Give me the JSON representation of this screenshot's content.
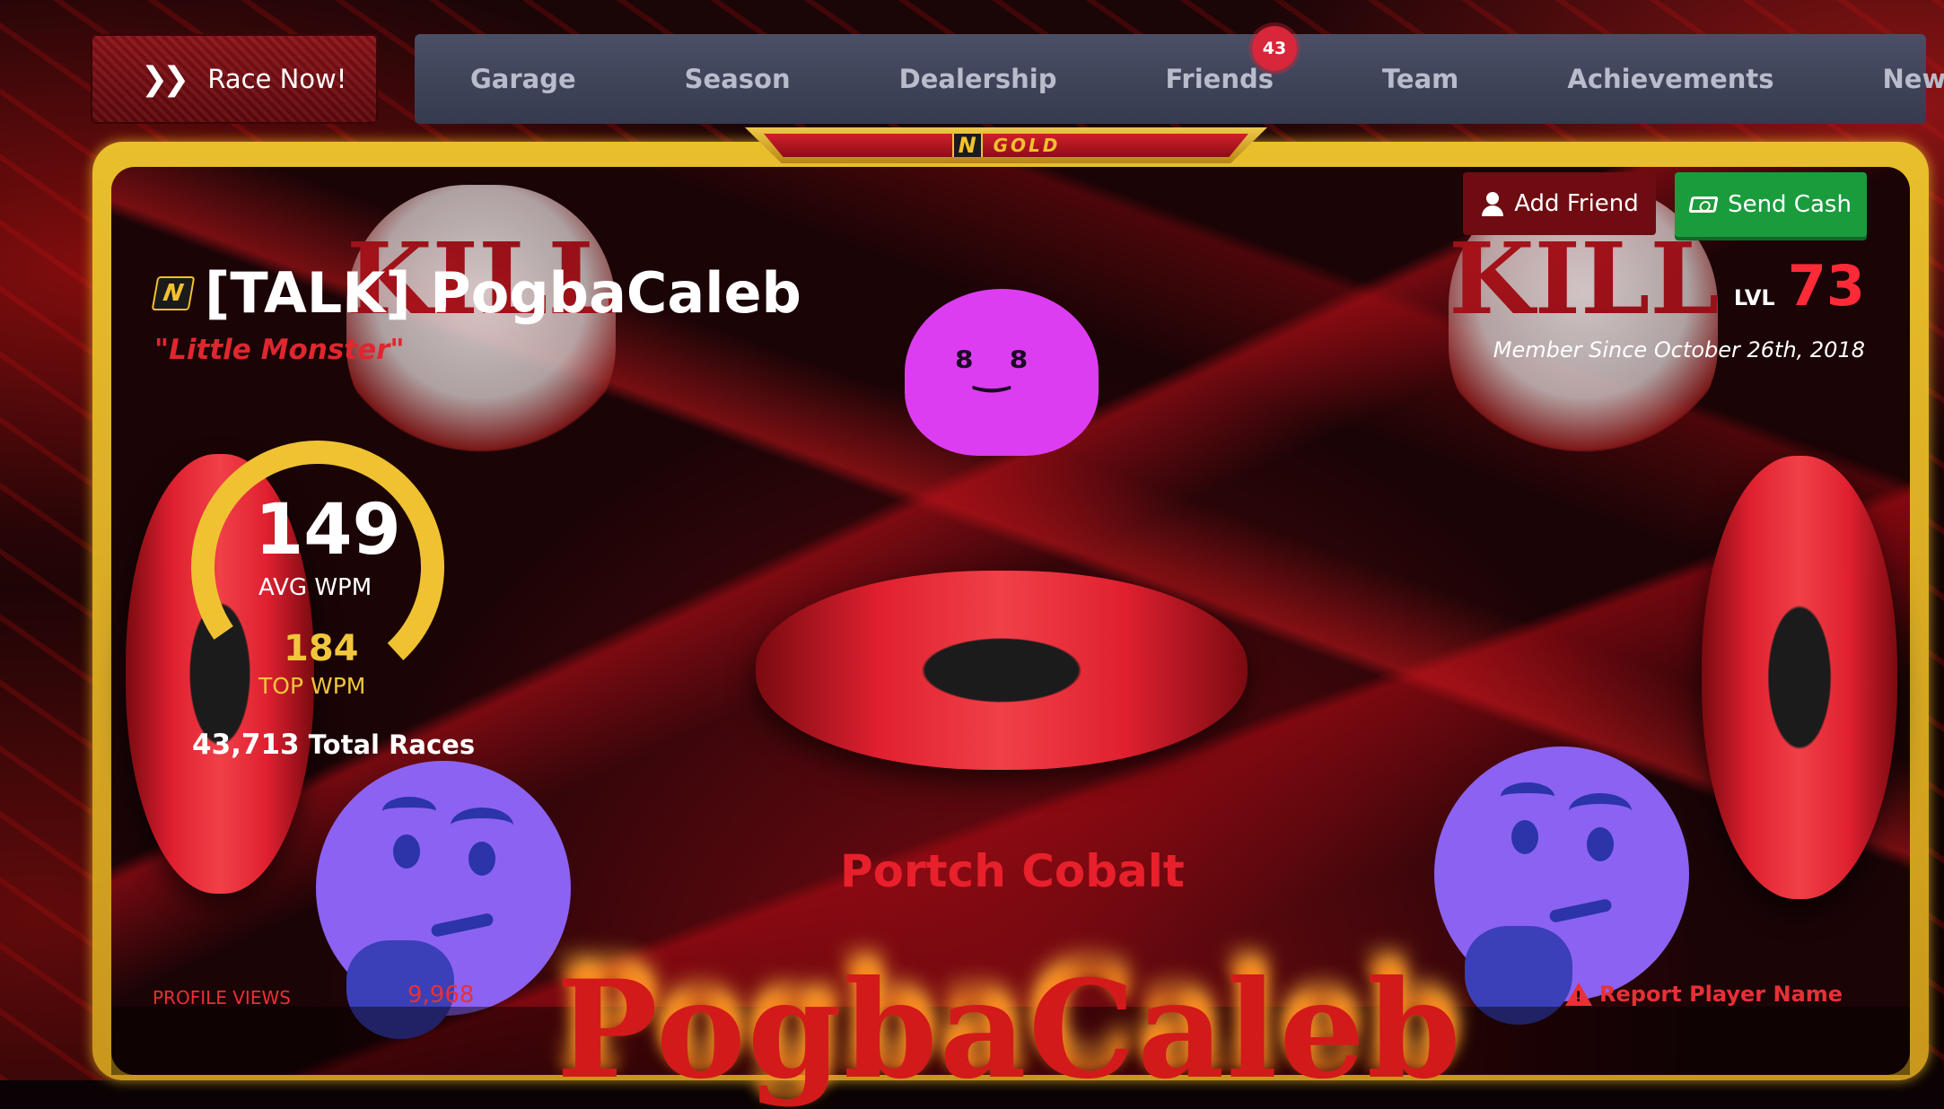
{
  "nav": {
    "race_now": "Race Now!",
    "items": [
      {
        "label": "Garage"
      },
      {
        "label": "Season"
      },
      {
        "label": "Dealership"
      },
      {
        "label": "Friends",
        "badge": "43"
      },
      {
        "label": "Team"
      },
      {
        "label": "Achievements"
      },
      {
        "label": "News"
      }
    ]
  },
  "membership": {
    "tier": "GOLD",
    "logo_letter": "N"
  },
  "profile": {
    "name": "[TALK] PogbaCaleb",
    "title": "\"Little Monster\"",
    "level_label": "LVL",
    "level": "73",
    "member_since": "Member Since October 26th, 2018",
    "add_friend": "Add Friend",
    "send_cash": "Send Cash",
    "avg_wpm": "149",
    "avg_wpm_label": "AVG WPM",
    "top_wpm": "184",
    "top_wpm_label": "TOP WPM",
    "total_races": "43,713",
    "total_races_label": "Total Races",
    "gauge_fraction": 0.81,
    "car_name": "Portch Cobalt",
    "display_name_banner": "PogbaCaleb",
    "profile_views_label": "PROFILE VIEWS",
    "profile_views": "9,968",
    "report_label": "Report Player Name",
    "skull_text": "KILL"
  },
  "colors": {
    "gold": "#e9bf2c",
    "accent_red": "#e8202c",
    "green": "#1a9c3c",
    "nav_bg": "#4a4f66"
  }
}
